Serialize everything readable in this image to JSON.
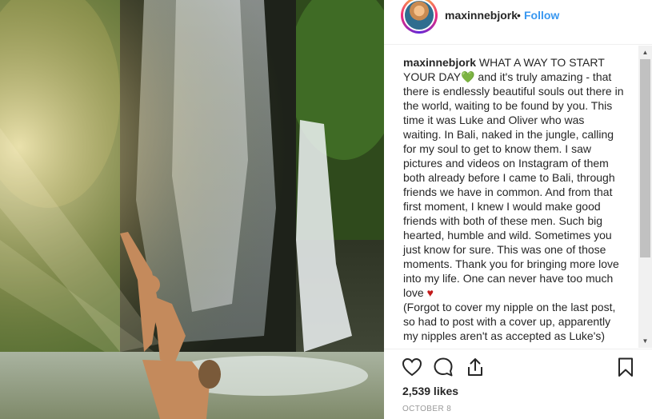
{
  "photo": {
    "alt_subject": "waterfall-photo"
  },
  "header": {
    "username": "maxinnebjork",
    "separator": "•",
    "follow_label": "Follow"
  },
  "caption": {
    "username": "maxinnebjork",
    "text_1": "WHAT A WAY TO START YOUR DAY",
    "green_heart": "💚",
    "text_2": " and it's truly amazing - that there is endlessly beautiful souls out there in the world, waiting to be found by you. This time it was Luke and Oliver who was waiting. In Bali, naked in the jungle, calling for my soul to get to know them. I saw pictures and videos on Instagram of them both already before I came to Bali, through friends we have in common. And from that first moment, I knew I would make good friends with both of these men. Such big hearted, humble and wild. Sometimes you just know for sure. This was one of those moments. Thank you for bringing more love into my life. One can never have too much love ",
    "red_heart": "♥",
    "text_3": "(Forgot to cover my nipple on the last post, so had to post with a cover up, apparently my nipples aren't as accepted as Luke's)"
  },
  "scrollbar": {
    "up": "▲",
    "down": "▼"
  },
  "actions": {
    "likes": "2,539 likes",
    "date": "OCTOBER 8",
    "icons": [
      "heart-outline-icon",
      "comment-icon",
      "share-icon",
      "bookmark-icon"
    ]
  },
  "colors": {
    "link": "#3897f0",
    "text": "#262626",
    "muted": "#999999"
  }
}
